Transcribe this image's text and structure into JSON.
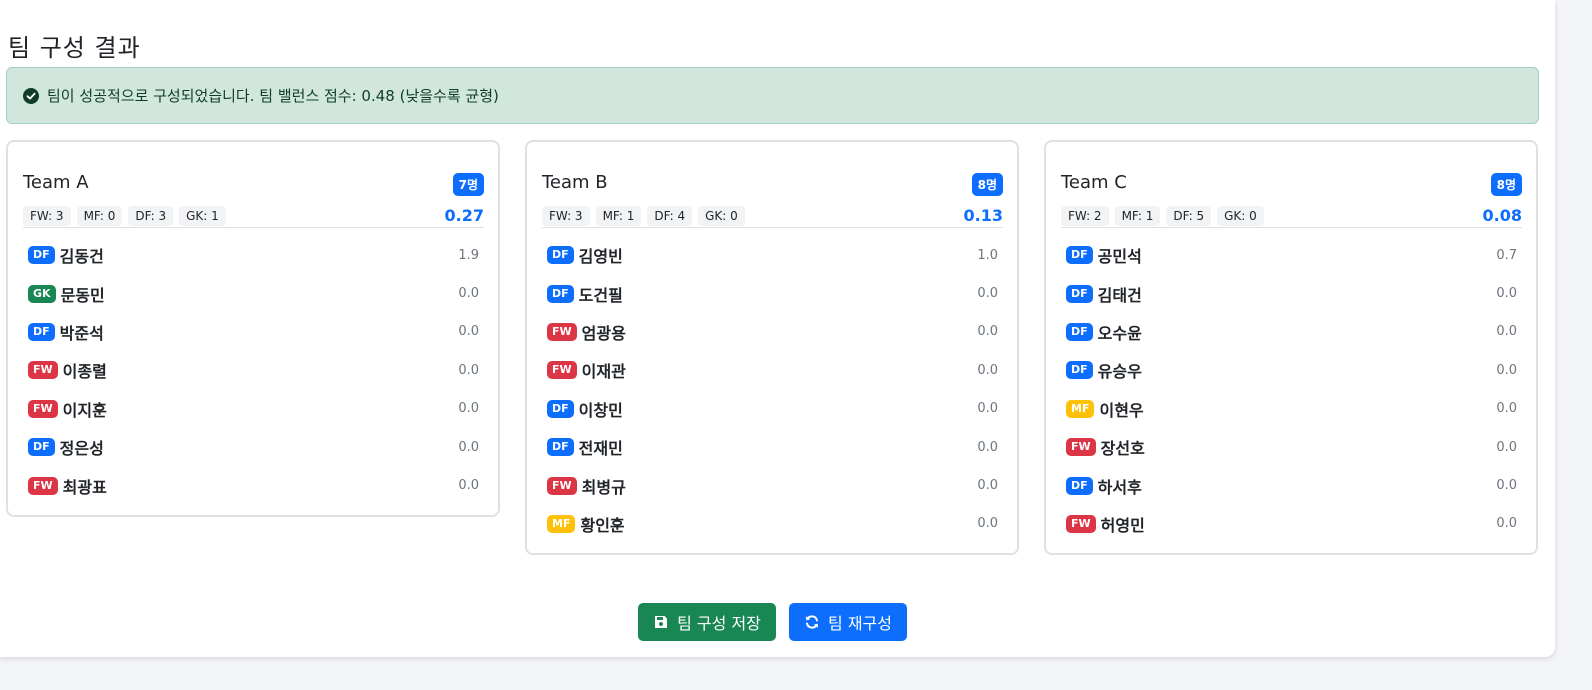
{
  "page": {
    "title": "팀 구성 결과"
  },
  "alert": {
    "text": "팀이 성공적으로 구성되었습니다. 팀 밸런스 점수: 0.48 (낮을수록 균형)",
    "icon": "check-circle-icon"
  },
  "teams": [
    {
      "name": "Team A",
      "count": "7명",
      "positions": {
        "fw": "FW: 3",
        "mf": "MF: 0",
        "df": "DF: 3",
        "gk": "GK: 1"
      },
      "score": "0.27",
      "players": [
        {
          "pos": "DF",
          "name": "김동건",
          "score": "1.9"
        },
        {
          "pos": "GK",
          "name": "문동민",
          "score": "0.0"
        },
        {
          "pos": "DF",
          "name": "박준석",
          "score": "0.0"
        },
        {
          "pos": "FW",
          "name": "이종렬",
          "score": "0.0"
        },
        {
          "pos": "FW",
          "name": "이지훈",
          "score": "0.0"
        },
        {
          "pos": "DF",
          "name": "정은성",
          "score": "0.0"
        },
        {
          "pos": "FW",
          "name": "최광표",
          "score": "0.0"
        }
      ]
    },
    {
      "name": "Team B",
      "count": "8명",
      "positions": {
        "fw": "FW: 3",
        "mf": "MF: 1",
        "df": "DF: 4",
        "gk": "GK: 0"
      },
      "score": "0.13",
      "players": [
        {
          "pos": "DF",
          "name": "김영빈",
          "score": "1.0"
        },
        {
          "pos": "DF",
          "name": "도건필",
          "score": "0.0"
        },
        {
          "pos": "FW",
          "name": "엄광용",
          "score": "0.0"
        },
        {
          "pos": "FW",
          "name": "이재관",
          "score": "0.0"
        },
        {
          "pos": "DF",
          "name": "이창민",
          "score": "0.0"
        },
        {
          "pos": "DF",
          "name": "전재민",
          "score": "0.0"
        },
        {
          "pos": "FW",
          "name": "최병규",
          "score": "0.0"
        },
        {
          "pos": "MF",
          "name": "황인훈",
          "score": "0.0"
        }
      ]
    },
    {
      "name": "Team C",
      "count": "8명",
      "positions": {
        "fw": "FW: 2",
        "mf": "MF: 1",
        "df": "DF: 5",
        "gk": "GK: 0"
      },
      "score": "0.08",
      "players": [
        {
          "pos": "DF",
          "name": "공민석",
          "score": "0.7"
        },
        {
          "pos": "DF",
          "name": "김태건",
          "score": "0.0"
        },
        {
          "pos": "DF",
          "name": "오수윤",
          "score": "0.0"
        },
        {
          "pos": "DF",
          "name": "유승우",
          "score": "0.0"
        },
        {
          "pos": "MF",
          "name": "이현우",
          "score": "0.0"
        },
        {
          "pos": "FW",
          "name": "장선호",
          "score": "0.0"
        },
        {
          "pos": "DF",
          "name": "하서후",
          "score": "0.0"
        },
        {
          "pos": "FW",
          "name": "허영민",
          "score": "0.0"
        }
      ]
    }
  ],
  "buttons": {
    "save": {
      "label": "팀 구성 저장",
      "icon": "save-icon"
    },
    "reform": {
      "label": "팀 재구성",
      "icon": "refresh-icon"
    }
  },
  "colors": {
    "primary": "#0d6efd",
    "success": "#198754",
    "danger": "#dc3545",
    "warning": "#ffc107",
    "alert_bg": "#d1e7dd"
  }
}
